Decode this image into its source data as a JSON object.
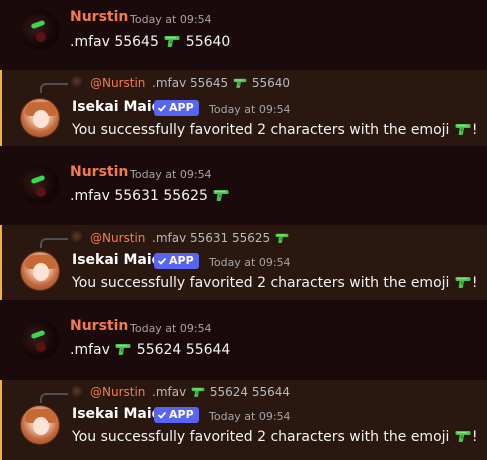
{
  "messages": [
    {
      "author": "Nurstin",
      "timestamp": "Today at 09:54",
      "pre": ".mfav 55645",
      "post": "55640"
    },
    {
      "reply_name": "@Nurstin",
      "reply_pre": ".mfav 55645",
      "reply_post": "55640",
      "author": "Isekai Maid",
      "badge": "APP",
      "timestamp": "Today at 09:54",
      "text": "You successfully favorited 2 characters with the emoji",
      "suffix": "!"
    },
    {
      "author": "Nurstin",
      "timestamp": "Today at 09:54",
      "pre": ".mfav 55631 55625",
      "post": ""
    },
    {
      "reply_name": "@Nurstin",
      "reply_pre": ".mfav 55631 55625",
      "reply_post": "",
      "author": "Isekai Maid",
      "badge": "APP",
      "timestamp": "Today at 09:54",
      "text": "You successfully favorited 2 characters with the emoji",
      "suffix": "!"
    },
    {
      "author": "Nurstin",
      "timestamp": "Today at 09:54",
      "pre": ".mfav",
      "post": "55624 55644"
    },
    {
      "reply_name": "@Nurstin",
      "reply_pre": ".mfav",
      "reply_post": "55624 55644",
      "author": "Isekai Maid",
      "badge": "APP",
      "timestamp": "Today at 09:54",
      "text": "You successfully favorited 2 characters with the emoji",
      "suffix": "!"
    }
  ],
  "colors": {
    "background": "#1a0a0b",
    "highlight_bg": "#2a1810",
    "highlight_border": "#f0b232",
    "user_name": "#f47b4e",
    "app_badge": "#5865f2",
    "emoji_green": "#4cc24f"
  },
  "icons": {
    "emoji": "water-pistol-icon",
    "badge": "verified-check-icon"
  }
}
